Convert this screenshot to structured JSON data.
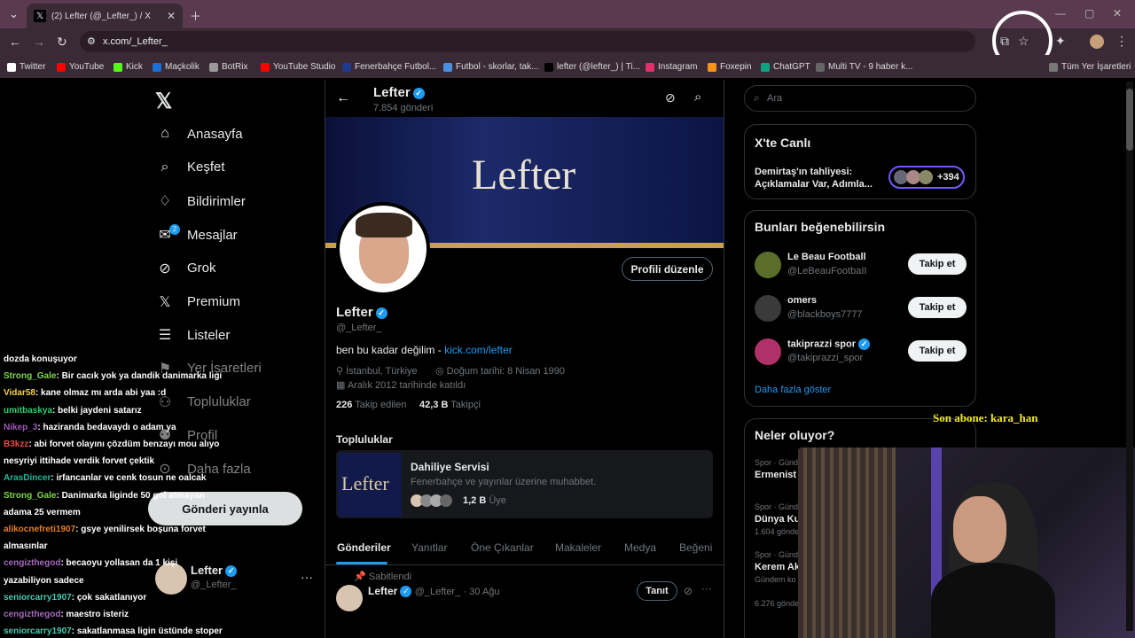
{
  "browser": {
    "tab_title": "(2) Lefter (@_Lefter_) / X",
    "url": "x.com/_Lefter_"
  },
  "bookmarks": [
    "Twitter",
    "YouTube",
    "Kick",
    "Maçkolik",
    "BotRix",
    "YouTube Studio",
    "Fenerbahçe Futbol...",
    "Futbol - skorlar, tak...",
    "lefter (@lefter_) | Ti...",
    "Instagram",
    "Foxepin",
    "ChatGPT",
    "Multi TV - 9 haber k..."
  ],
  "bookmarks_all": "Tüm Yer İşaretleri",
  "nav": [
    "Anasayfa",
    "Keşfet",
    "Bildirimler",
    "Mesajlar",
    "Grok",
    "Premium",
    "Listeler",
    "Yer İşaretleri",
    "Topluluklar",
    "Profil",
    "Daha fazla"
  ],
  "messages_badge": "2",
  "post_button": "Gönderi yayınla",
  "account": {
    "name": "Lefter",
    "handle": "@_Lefter_"
  },
  "profile": {
    "top_name": "Lefter",
    "post_count": "7.854 gönderi",
    "banner_text": "Lefter",
    "edit_button": "Profili düzenle",
    "name": "Lefter",
    "handle": "@_Lefter_",
    "bio_text": "ben bu kadar değilim - ",
    "bio_link": "kick.com/lefter",
    "location": "İstanbul, Türkiye",
    "birthday": "Doğum tarihi: 8 Nisan 1990",
    "joined": "Aralık 2012 tarihinde katıldı",
    "following_count": "226",
    "following_label": "Takip edilen",
    "followers_count": "42,3 B",
    "followers_label": "Takipçi"
  },
  "communities": {
    "heading": "Topluluklar",
    "name": "Dahiliye Servisi",
    "desc": "Fenerbahçe ve yayınlar üzerine muhabbet.",
    "members": "1,2 B",
    "members_label": "Üye"
  },
  "tabs": [
    "Gönderiler",
    "Yanıtlar",
    "Öne Çıkanlar",
    "Makaleler",
    "Medya",
    "Beğeni"
  ],
  "pinned": {
    "label": "Sabitlendi",
    "name": "Lefter",
    "handle": "@_Lefter_",
    "date": "· 30 Ağu",
    "button": "Tanıt"
  },
  "search": {
    "placeholder": "Ara"
  },
  "live": {
    "heading": "X'te Canlı",
    "text": "Demirtaş'ın tahliyesi: Açıklamalar Var, Adımla...",
    "count": "+394"
  },
  "suggest": {
    "heading": "Bunları beğenebilirsin",
    "users": [
      {
        "name": "Le Beau Football",
        "handle": "@LeBeauFootbaII",
        "button": "Takip et"
      },
      {
        "name": "omers",
        "handle": "@blackboys7777",
        "button": "Takip et"
      },
      {
        "name": "takiprazzi spor",
        "handle": "@takiprazzi_spor",
        "button": "Takip et"
      }
    ],
    "more": "Daha fazla göster"
  },
  "trends": {
    "heading": "Neler oluyor?",
    "items": [
      {
        "meta": "Spor · Gündem",
        "title": "Ermenist"
      },
      {
        "meta": "Spor · Gündem",
        "title": "Dünya Ku",
        "sub": "1.604 göndeı"
      },
      {
        "meta": "Spor · Gündem",
        "title": "Kerem Ak",
        "sub": "Gündem ko"
      },
      {
        "sub": "6.276 gönder"
      }
    ]
  },
  "overlay": {
    "last_sub": "Son abone: kara_han"
  },
  "chat": [
    {
      "user": "Strong_Gale",
      "msg": ": Bir cacık yok ya dandik danimarka ligi",
      "color": "#7fd64b"
    },
    {
      "user": "Vidar58",
      "msg": ": kane olmaz mı arda abi yaa :d",
      "color": "#f4d03f"
    },
    {
      "user": "umitbaskya",
      "msg": ": belki jaydeni satarız",
      "color": "#2ecc71"
    },
    {
      "user": "Nikep_3",
      "msg": ": haziranda bedavaydı o adam ya",
      "color": "#9b59b6"
    },
    {
      "user": "B3kzz",
      "msg": ": abi forvet olayını çözdüm benzayı mou alıyo",
      "color": "#e74c3c"
    },
    {
      "user": "ArasDincer",
      "msg": ": irfancanlar ve cenk tosun ne oalcak",
      "color": "#1abc9c"
    },
    {
      "user": "Strong_Gale",
      "msg": ": Danimarka liginde 50 gol atmayan",
      "color": "#7fd64b"
    },
    {
      "user": "alikocnefreti1907",
      "msg": ": gsye yenilirsek boşuna forvet",
      "color": "#e67e22"
    },
    {
      "user": "cengizthegod",
      "msg": ": becaoyu yollasan da 1 kişi",
      "color": "#a569bd"
    },
    {
      "user": "seniorcarry1907",
      "msg": ": çok sakatlanıyor",
      "color": "#48c9b0"
    },
    {
      "user": "cengizthegod",
      "msg": ": maestro isteriz",
      "color": "#a569bd"
    },
    {
      "user": "seniorcarry1907",
      "msg": ": sakatlanmasa ligin üstünde stoper",
      "color": "#48c9b0"
    }
  ],
  "chat_cont": [
    "dozda konuşuyor",
    "nesyriyi ittihade verdik forvet çektik",
    "adama 25 vermem",
    "almasınlar",
    "yazabiliyon sadece"
  ]
}
